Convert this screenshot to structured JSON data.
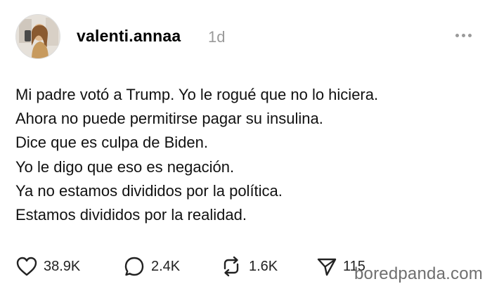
{
  "post": {
    "username": "valenti.annaa",
    "time": "1d",
    "lines": [
      "Mi padre votó a Trump. Yo le rogué que no lo hiciera.",
      "Ahora no puede permitirse pagar su insulina.",
      "Dice que es culpa de Biden.",
      "Yo le digo que eso es negación.",
      "Ya no estamos divididos por la política.",
      "Estamos divididos por la realidad."
    ]
  },
  "actions": {
    "likes": "38.9K",
    "comments": "2.4K",
    "reposts": "1.6K",
    "shares": "115"
  },
  "icons": {
    "more": "more-options-icon",
    "like": "heart-icon",
    "comment": "speech-bubble-icon",
    "repost": "repost-icon",
    "share": "send-icon"
  },
  "watermark": "boredpanda.com"
}
